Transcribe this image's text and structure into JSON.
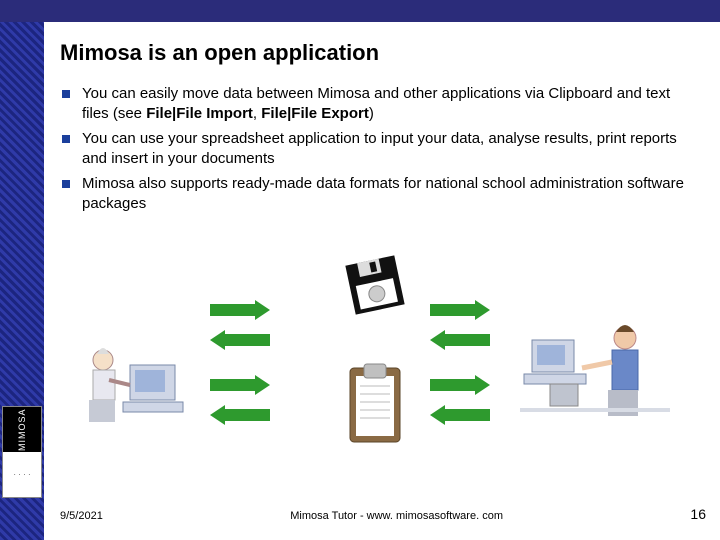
{
  "slide": {
    "title": "Mimosa is an open application",
    "bullets": [
      {
        "pre": "You can easily move data between Mimosa and other applications via Clipboard and text files (see ",
        "b1": "File|File Import",
        "mid": ", ",
        "b2": "File|File Export",
        "post": ")"
      },
      {
        "text": "You can use your spreadsheet application to input your data, analyse results, print reports and insert in your documents"
      },
      {
        "text": "Mimosa also supports ready-made data formats for national school administration software packages"
      }
    ]
  },
  "logo": {
    "top": "MIMOSA",
    "bot": "· · · ·"
  },
  "footer": {
    "date": "9/5/2021",
    "center": "Mimosa Tutor - www. mimosasoftware. com",
    "page": "16"
  },
  "colors": {
    "arrow": "#2e9a2e",
    "bullet": "#1b3f9c"
  }
}
